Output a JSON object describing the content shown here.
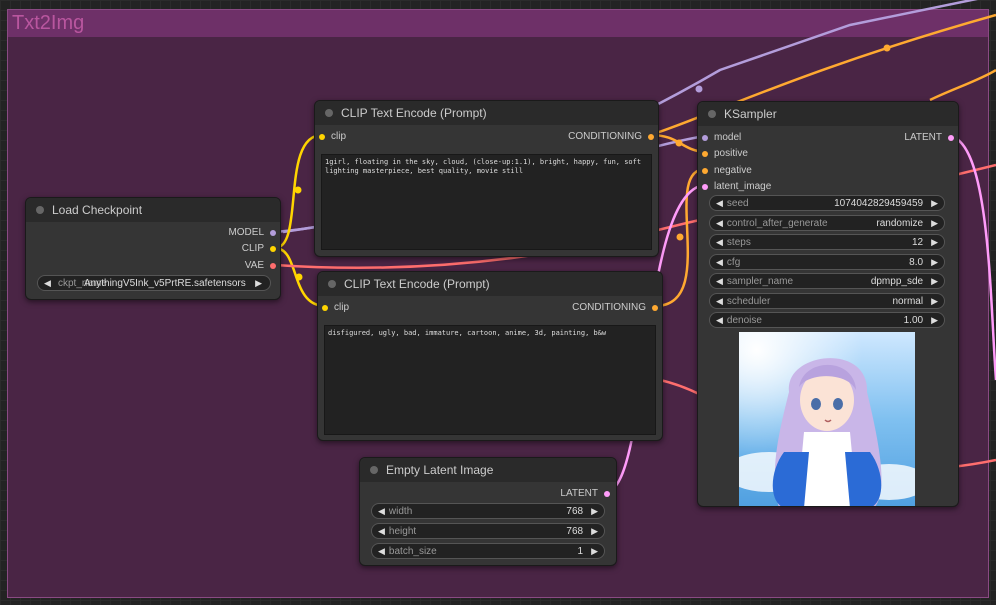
{
  "group": {
    "title": "Txt2Img"
  },
  "clip_pos": {
    "title": "CLIP Text Encode (Prompt)",
    "input": "clip",
    "output": "CONDITIONING",
    "text": "1girl, floating in the sky, cloud, (close-up:1.1), bright, happy, fun, soft lighting masterpiece, best quality, movie still"
  },
  "clip_neg": {
    "title": "CLIP Text Encode (Prompt)",
    "input": "clip",
    "output": "CONDITIONING",
    "text": "disfigured, ugly, bad, immature, cartoon, anime, 3d, painting, b&w"
  },
  "load_ckpt": {
    "title": "Load Checkpoint",
    "outputs": [
      "MODEL",
      "CLIP",
      "VAE"
    ],
    "ckpt_label": "ckpt_name",
    "ckpt_value": "AnythingV5Ink_v5PrtRE.safetensors"
  },
  "empty_latent": {
    "title": "Empty Latent Image",
    "output": "LATENT",
    "widgets": [
      {
        "label": "width",
        "value": "768"
      },
      {
        "label": "height",
        "value": "768"
      },
      {
        "label": "batch_size",
        "value": "1"
      }
    ]
  },
  "ksampler": {
    "title": "KSampler",
    "inputs": [
      "model",
      "positive",
      "negative",
      "latent_image"
    ],
    "output": "LATENT",
    "widgets": [
      {
        "label": "seed",
        "value": "1074042829459459"
      },
      {
        "label": "control_after_generate",
        "value": "randomize"
      },
      {
        "label": "steps",
        "value": "12"
      },
      {
        "label": "cfg",
        "value": "8.0"
      },
      {
        "label": "sampler_name",
        "value": "dpmpp_sde"
      },
      {
        "label": "scheduler",
        "value": "normal"
      },
      {
        "label": "denoise",
        "value": "1.00"
      }
    ]
  },
  "colors": {
    "model": "#b39ddb",
    "clip": "#ffd500",
    "vae": "#ff6e6e",
    "conditioning": "#ffa931",
    "latent": "#ff9cf9",
    "group_bg": "#4a2545",
    "group_header": "#6e3068"
  }
}
